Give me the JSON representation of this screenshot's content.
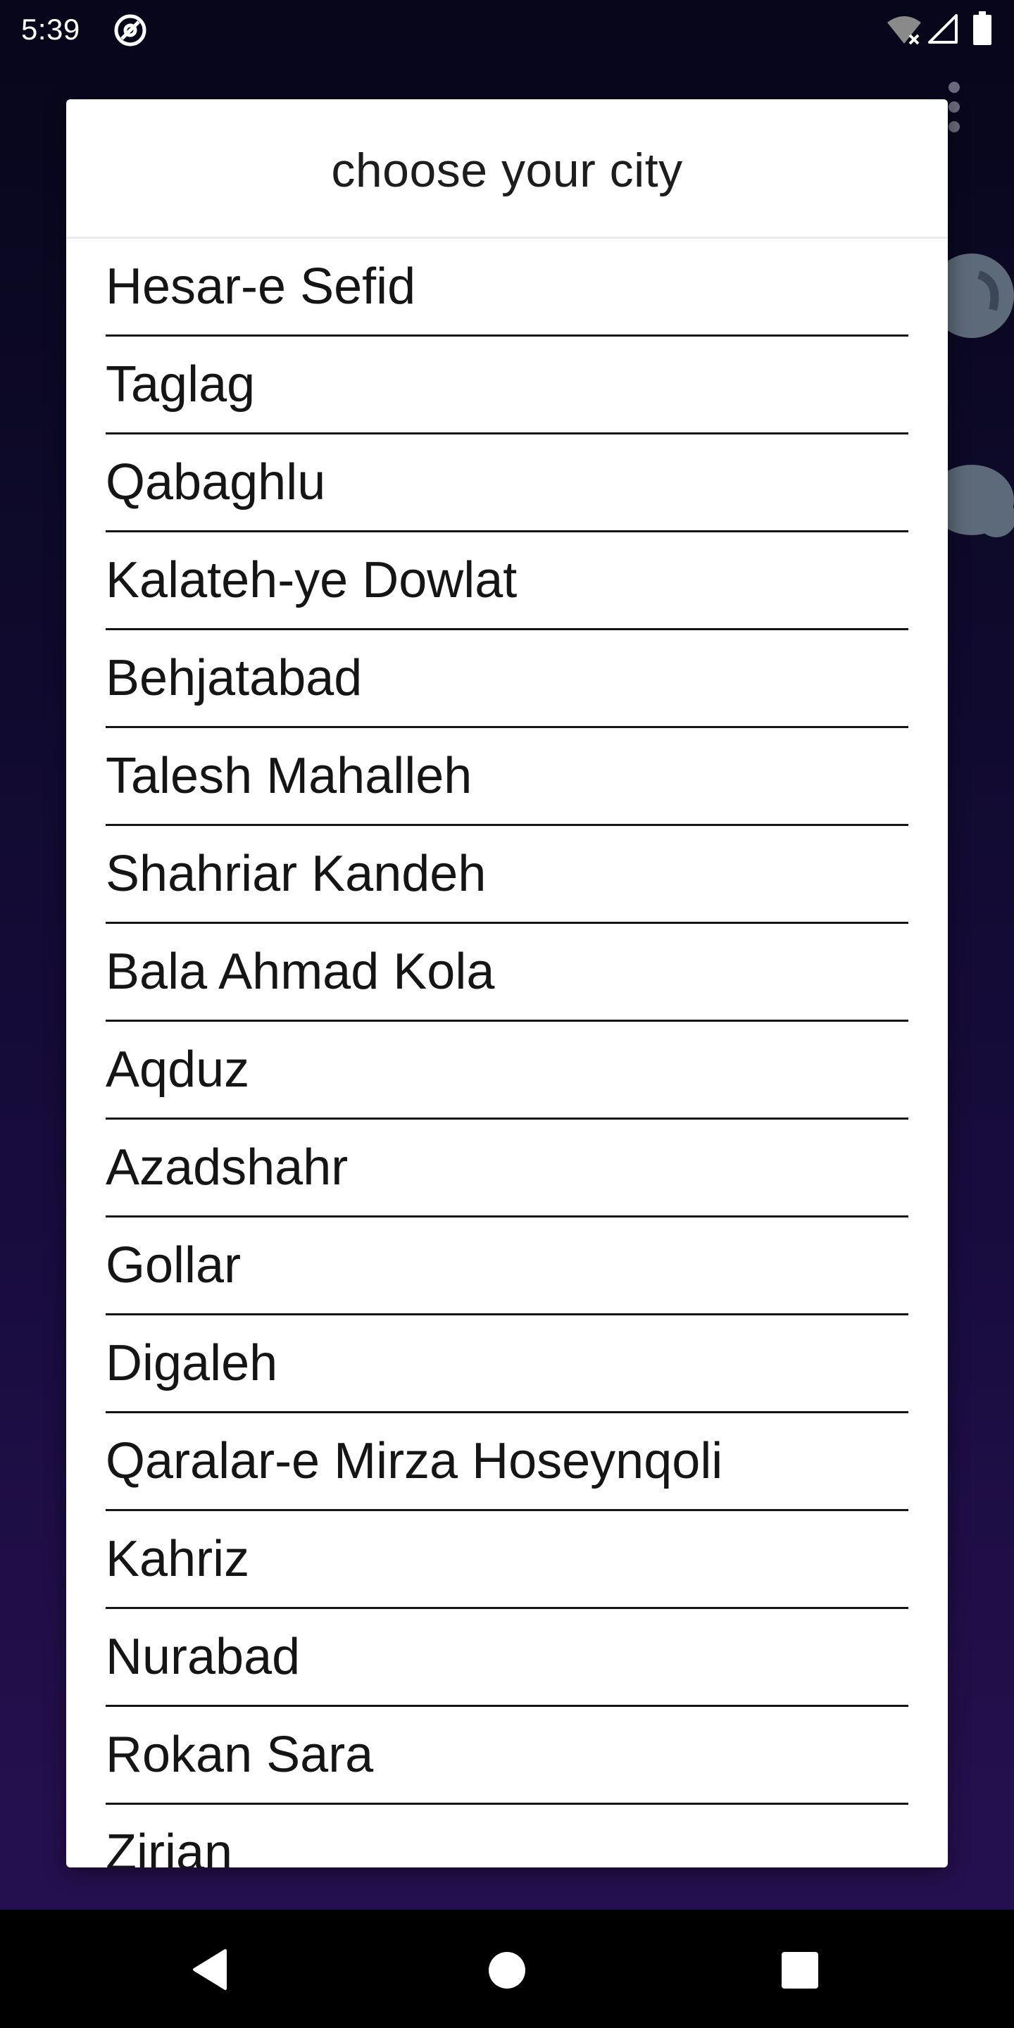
{
  "status_bar": {
    "time": "5:39",
    "icons": [
      "at-sign-icon",
      "wifi-off-icon",
      "signal-icon",
      "battery-icon"
    ]
  },
  "background": {
    "icons": [
      "overflow-menu-icon",
      "weather-icon",
      "cloud-icon"
    ]
  },
  "dialog": {
    "title": "choose your city",
    "cities": [
      "Hesar-e Sefid",
      "Taglag",
      "Qabaghlu",
      "Kalateh-ye Dowlat",
      "Behjatabad",
      "Talesh Mahalleh",
      "Shahriar Kandeh",
      "Bala Ahmad Kola",
      "Aqduz",
      "Azadshahr",
      "Gollar",
      "Digaleh",
      "Qaralar-e Mirza Hoseynqoli",
      "Kahriz",
      "Nurabad",
      "Rokan Sara",
      "Zirian"
    ]
  },
  "nav_bar": {
    "icons": [
      "back-icon",
      "home-icon",
      "recents-icon"
    ]
  },
  "colors": {
    "background_top": "#07061a",
    "background_bottom": "#25104f",
    "dialog_background": "#ffffff",
    "text": "#151515",
    "nav_bar": "#000000"
  }
}
